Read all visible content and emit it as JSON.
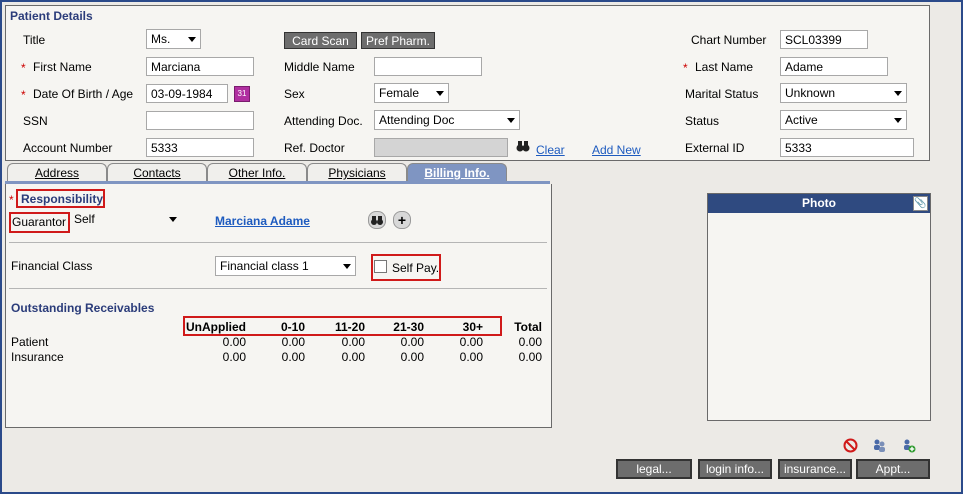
{
  "patient_details": {
    "title": "Patient Details",
    "labels": {
      "title": "Title",
      "first_name": "First Name",
      "dob_age": "Date Of Birth / Age",
      "ssn": "SSN",
      "account_number": "Account Number",
      "middle_name": "Middle Name",
      "sex": "Sex",
      "attending_doc": "Attending Doc.",
      "ref_doctor": "Ref. Doctor",
      "chart_number": "Chart Number",
      "last_name": "Last Name",
      "marital_status": "Marital Status",
      "status": "Status",
      "external_id": "External ID"
    },
    "values": {
      "title": "Ms.",
      "first_name": "Marciana",
      "dob": "03-09-1984",
      "ssn": "",
      "account_number": "5333",
      "middle_name": "",
      "sex": "Female",
      "attending_doc": "Attending Doc",
      "ref_doctor": "",
      "chart_number": "SCL03399",
      "last_name": "Adame",
      "marital_status": "Unknown",
      "status": "Active",
      "external_id": "5333"
    },
    "buttons": {
      "card_scan": "Card Scan",
      "pref_pharm": "Pref Pharm."
    },
    "links": {
      "clear": "Clear",
      "add_new": "Add New"
    },
    "required_mark": "*"
  },
  "tabs": [
    {
      "label": "Address"
    },
    {
      "label": "Contacts"
    },
    {
      "label": "Other Info."
    },
    {
      "label": "Physicians"
    },
    {
      "label": "Billing Info."
    }
  ],
  "billing": {
    "responsibility": "Responsibility",
    "guarantor_label": "Guarantor",
    "guarantor_value": "Self",
    "guarantor_name": "Marciana Adame",
    "financial_class_label": "Financial Class",
    "financial_class_value": "Financial class 1",
    "self_pay_label": "Self Pay.",
    "outstanding_title": "Outstanding Receivables",
    "columns": [
      "UnApplied",
      "0-10",
      "11-20",
      "21-30",
      "30+",
      "Total"
    ],
    "rows": [
      {
        "label": "Patient",
        "values": [
          "0.00",
          "0.00",
          "0.00",
          "0.00",
          "0.00",
          "0.00"
        ]
      },
      {
        "label": "Insurance",
        "values": [
          "0.00",
          "0.00",
          "0.00",
          "0.00",
          "0.00",
          "0.00"
        ]
      }
    ]
  },
  "photo": {
    "title": "Photo"
  },
  "bottom_buttons": {
    "legal": "legal...",
    "login_info": "login info...",
    "insurance": "insurance...",
    "appt": "Appt..."
  },
  "colors": {
    "accent": "#2f4a80",
    "highlight": "#d01a1a",
    "link": "#1e5bbf"
  }
}
